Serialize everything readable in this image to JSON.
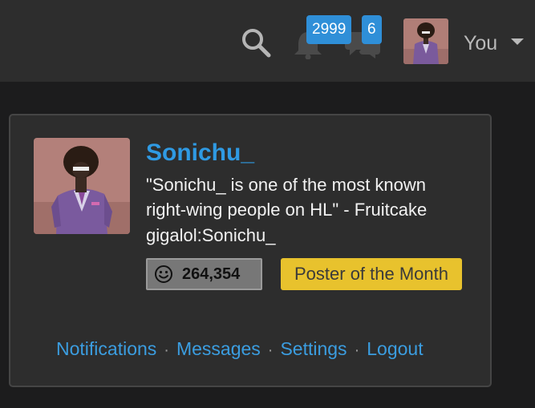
{
  "header": {
    "search_icon": "search-icon",
    "alerts_icon": "bell-icon",
    "conversations_icon": "chat-bubbles-icon",
    "alerts_count": "2999",
    "conversations_count": "6",
    "user_label": "You",
    "menu_icon": "caret-down-icon"
  },
  "profile": {
    "username": "Sonichu_",
    "status_lines": [
      "\"Sonichu_ is one of the most known",
      "right-wing people on HL\" - Fruitcake",
      "gigalol:Sonichu_"
    ],
    "reaction_icon": "smile-icon",
    "reaction_score": "264,354",
    "award": "Poster of the Month"
  },
  "menu_links": [
    "Notifications",
    "Messages",
    "Settings",
    "Logout"
  ],
  "separator": "·",
  "colors": {
    "topbar": "#2d2d2d",
    "page": "#1c1c1d",
    "badge": "#2f8fd8",
    "link": "#3b9de0",
    "username": "#2f9ae3",
    "award": "#e8c22d"
  }
}
